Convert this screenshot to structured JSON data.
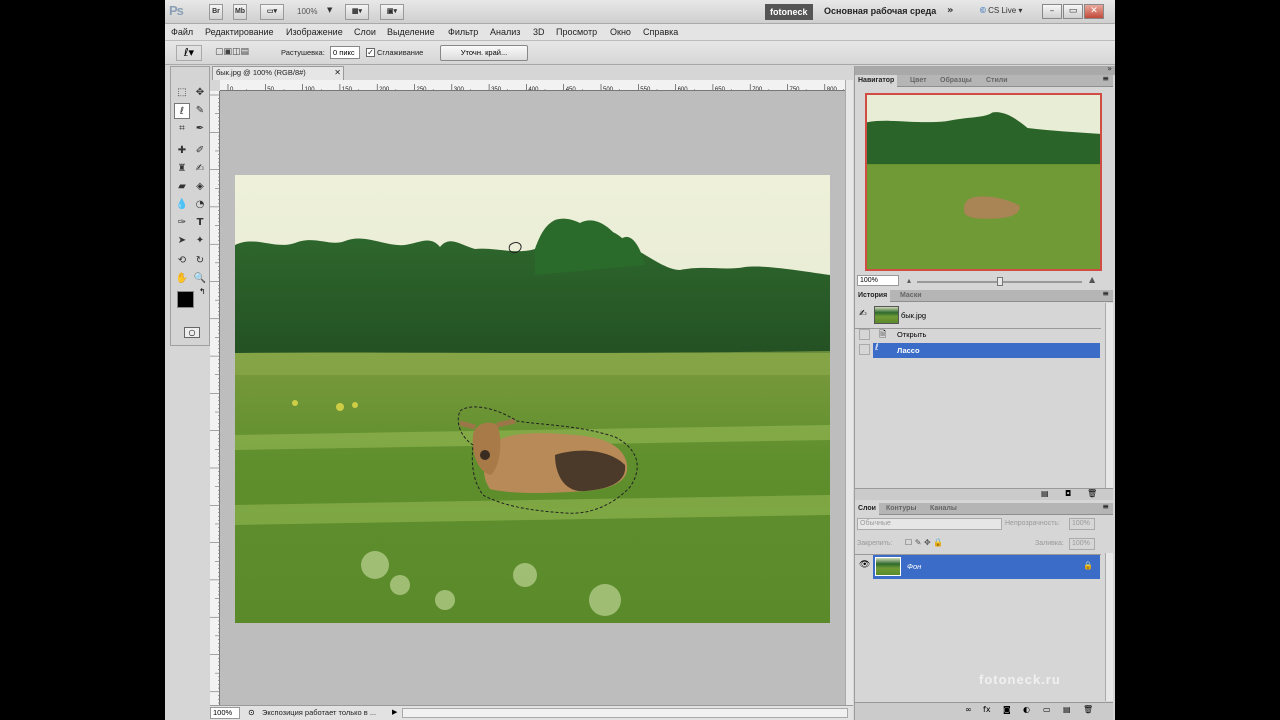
{
  "appbar": {
    "logo": "Ps",
    "br": "Br",
    "mb": "Mb",
    "zoom": "100%",
    "workspace_tag": "fotoneck",
    "workspace": "Основная рабочая среда",
    "cslive": "CS Live"
  },
  "menu": [
    "Файл",
    "Редактирование",
    "Изображение",
    "Слои",
    "Выделение",
    "Фильтр",
    "Анализ",
    "3D",
    "Просмотр",
    "Окно",
    "Справка"
  ],
  "options": {
    "feather_label": "Растушевка:",
    "feather_value": "0 пикс",
    "antialias_label": "Сглаживание",
    "refine_button": "Уточн. край..."
  },
  "document": {
    "tab_title": "бык.jpg @ 100% (RGB/8#)",
    "ruler_top": [
      "0",
      "50",
      "100",
      "150",
      "200",
      "250",
      "300",
      "350",
      "400",
      "450",
      "500",
      "550",
      "600",
      "650",
      "700",
      "750",
      "800"
    ]
  },
  "status": {
    "zoom": "100%",
    "text": "Экспозиция работает только в ..."
  },
  "navigator": {
    "tabs": [
      "Навигатор",
      "Цвет",
      "Образцы",
      "Стили"
    ],
    "zoom": "100%"
  },
  "history": {
    "tabs": [
      "История",
      "Маски"
    ],
    "snapshot": "бык.jpg",
    "items": [
      "Открыть",
      "Лассо"
    ],
    "active_index": 1
  },
  "layers": {
    "tabs": [
      "Слои",
      "Контуры",
      "Каналы"
    ],
    "blend_mode": "Обычные",
    "opacity_label": "Непрозрачность:",
    "opacity": "100%",
    "lock_label": "Закрепить:",
    "fill_label": "Заливка:",
    "fill": "100%",
    "layer_name": "Фон"
  },
  "watermark": "fotoneck.ru",
  "colors": {
    "accent": "#3b6cc7",
    "navigator_frame": "#d14c43"
  }
}
